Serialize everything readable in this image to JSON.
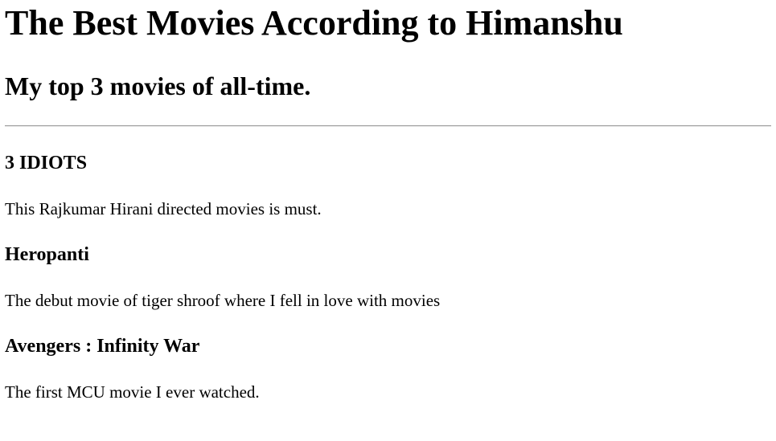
{
  "header": {
    "title": "The Best Movies According to Himanshu",
    "subtitle": "My top 3 movies of all-time."
  },
  "movies": [
    {
      "title": "3 IDIOTS",
      "description": "This Rajkumar Hirani directed movies is must."
    },
    {
      "title": "Heropanti",
      "description": "The debut movie of tiger shroof where I fell in love with movies"
    },
    {
      "title": "Avengers : Infinity War",
      "description": "The first MCU movie I ever watched."
    }
  ]
}
